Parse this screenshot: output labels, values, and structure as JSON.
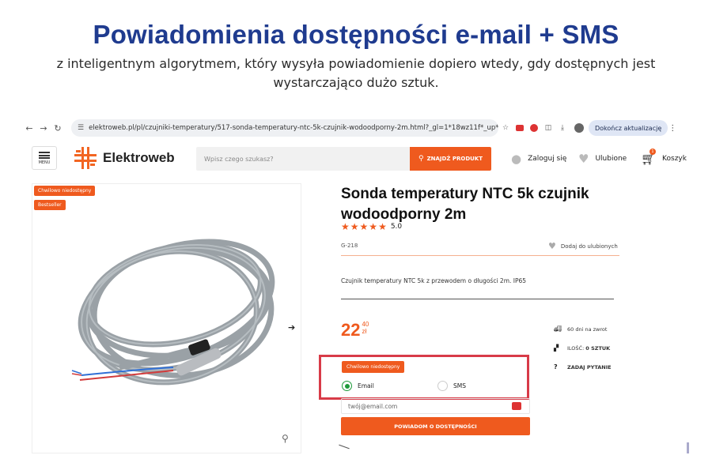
{
  "promo": {
    "headline": "Powiadomienia dostępności e-mail + SMS",
    "subline": "z inteligentnym algorytmem, który wysyła powiadomienie dopiero wtedy, gdy dostępnych jest wystarczająco dużo sztuk."
  },
  "browser": {
    "url": "elektroweb.pl/pl/czujniki-temperatury/517-sonda-temperatury-ntc-5k-czujnik-wodoodporny-2m.html?_gl=1*18wz11f*_up*M...",
    "update_label": "Dokończ aktualizację"
  },
  "header": {
    "menu_label": "MENU",
    "logo_text": "Elektroweb",
    "search_placeholder": "Wpisz czego szukasz?",
    "search_button": "ZNAJDŹ PRODUKT",
    "login": "Zaloguj się",
    "favorites": "Ulubione",
    "cart": "Koszyk",
    "cart_count": "1"
  },
  "product": {
    "badges": [
      "Chwilowo niedostępny",
      "Bestseller"
    ],
    "title": "Sonda temperatury NTC 5k czujnik wodoodporny 2m",
    "rating": "5.0",
    "rating_stars": 5,
    "sku": "G-218",
    "add_favorite": "Dodaj do ulubionych",
    "description": "Czujnik temperatury NTC 5k z przewodem o długości 2m. IP65",
    "price_int": "22",
    "price_frac": "40",
    "currency": "zł",
    "info": {
      "returns": "60 dni na zwrot",
      "stock_label": "ILOŚĆ:",
      "stock_value": "0 SZTUK",
      "ask": "ZADAJ PYTANIE"
    }
  },
  "notify": {
    "status_badge": "Chwilowo niedostępny",
    "option_email": "Email",
    "option_sms": "SMS",
    "selected": "Email",
    "email_placeholder": "twój@email.com",
    "button": "POWIADOM O DOSTĘPNOŚCI"
  },
  "colors": {
    "accent": "#ef5a1e",
    "headline": "#1f3b8f",
    "highlight": "#d83b48",
    "radio_selected": "#1e9a3a"
  }
}
